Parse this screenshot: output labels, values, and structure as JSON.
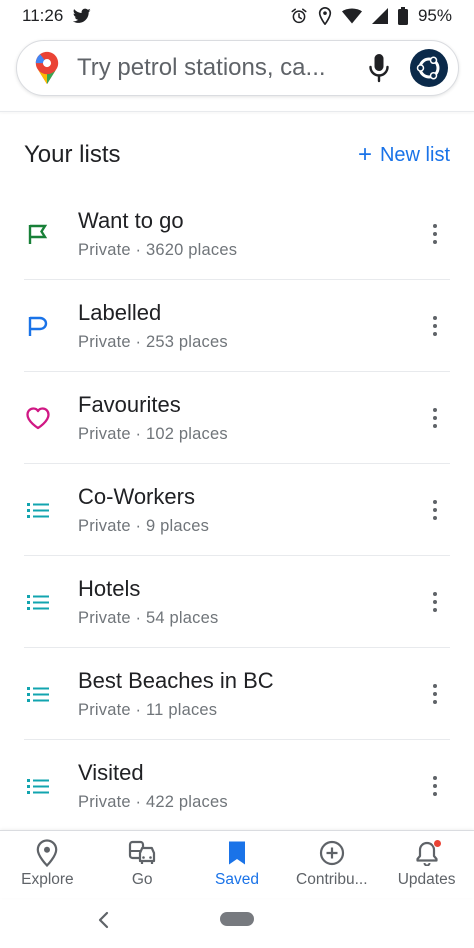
{
  "status_bar": {
    "time": "11:26",
    "battery": "95%"
  },
  "search": {
    "placeholder": "Try petrol stations, ca..."
  },
  "lists_header": {
    "title": "Your lists",
    "new_list_label": "New list",
    "new_list_plus": "+"
  },
  "lists": [
    {
      "title": "Want to go",
      "subtitle": "Private · 3620 places",
      "icon": "flag-icon",
      "icon_color": "#188038"
    },
    {
      "title": "Labelled",
      "subtitle": "Private · 253 places",
      "icon": "label-flag-icon",
      "icon_color": "#1a73e8"
    },
    {
      "title": "Favourites",
      "subtitle": "Private · 102 places",
      "icon": "heart-icon",
      "icon_color": "#d01884"
    },
    {
      "title": "Co-Workers",
      "subtitle": "Private · 9 places",
      "icon": "list-icon",
      "icon_color": "#12a4af"
    },
    {
      "title": "Hotels",
      "subtitle": "Private · 54 places",
      "icon": "list-icon",
      "icon_color": "#12a4af"
    },
    {
      "title": "Best Beaches in BC",
      "subtitle": "Private · 11 places",
      "icon": "list-icon",
      "icon_color": "#12a4af"
    },
    {
      "title": "Visited",
      "subtitle": "Private · 422 places",
      "icon": "list-icon",
      "icon_color": "#12a4af"
    }
  ],
  "bottom_nav": {
    "items": [
      {
        "label": "Explore",
        "icon": "location-pin-icon"
      },
      {
        "label": "Go",
        "icon": "commute-icon"
      },
      {
        "label": "Saved",
        "icon": "bookmark-icon",
        "active": true
      },
      {
        "label": "Contribu...",
        "icon": "add-circle-icon"
      },
      {
        "label": "Updates",
        "icon": "bell-icon",
        "has_badge": true
      }
    ]
  },
  "colors": {
    "accent": "#1a73e8",
    "text_primary": "#202124",
    "text_secondary": "#70757a",
    "badge": "#ea4335"
  }
}
